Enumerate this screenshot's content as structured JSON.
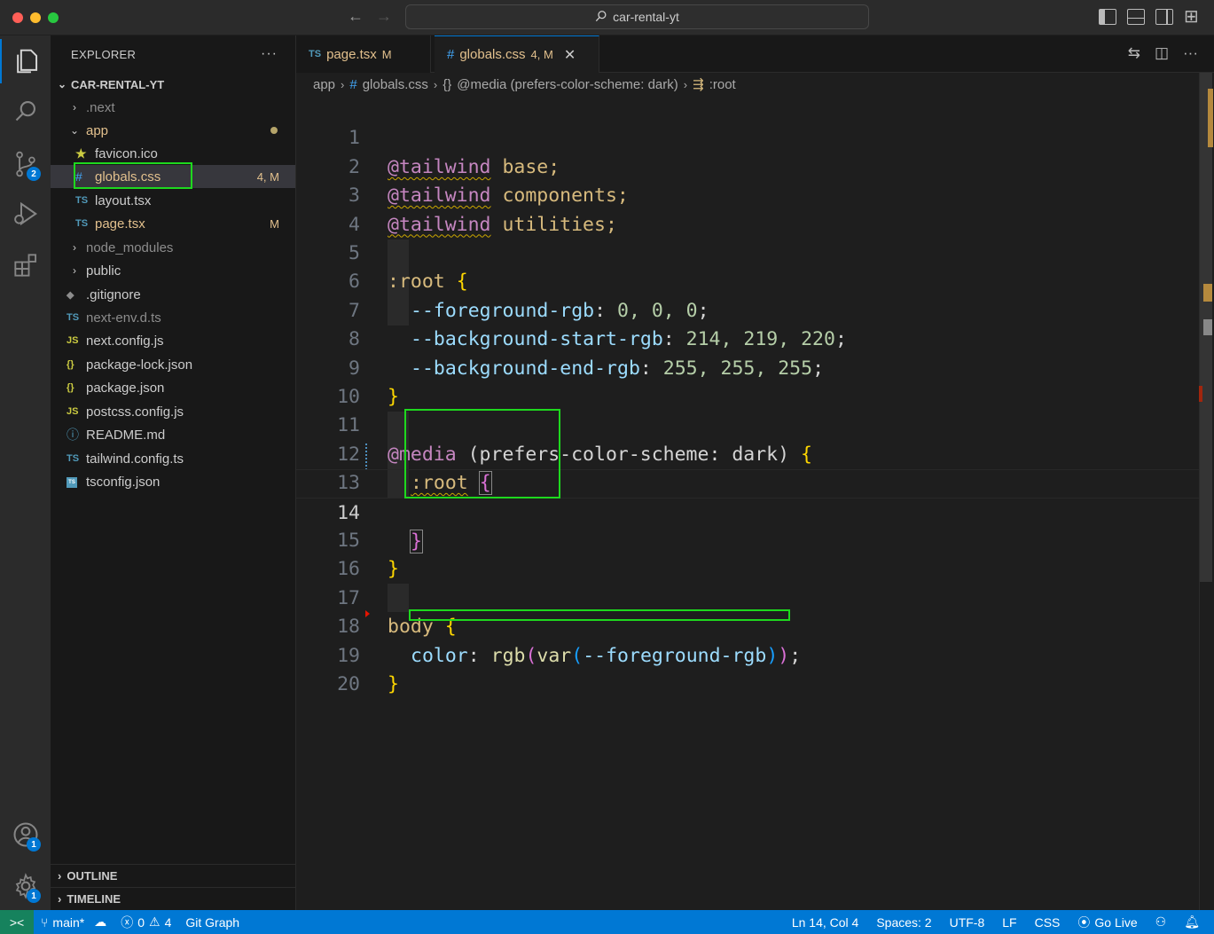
{
  "window": {
    "title": "car-rental-yt"
  },
  "sidebar": {
    "title": "EXPLORER",
    "more": "···",
    "root": "CAR-RENTAL-YT",
    "items": [
      {
        "label": ".next",
        "type": "folder"
      },
      {
        "label": "app",
        "type": "folder-open"
      },
      {
        "label": "favicon.ico",
        "icon": "star-icon"
      },
      {
        "label": "globals.css",
        "icon": "#",
        "badge": "4, M"
      },
      {
        "label": "layout.tsx",
        "icon": "TS"
      },
      {
        "label": "page.tsx",
        "icon": "TS",
        "badge": "M"
      },
      {
        "label": "node_modules",
        "type": "folder"
      },
      {
        "label": "public",
        "type": "folder"
      },
      {
        "label": ".gitignore",
        "icon": "◆"
      },
      {
        "label": "next-env.d.ts",
        "icon": "TS"
      },
      {
        "label": "next.config.js",
        "icon": "JS"
      },
      {
        "label": "package-lock.json",
        "icon": "{}"
      },
      {
        "label": "package.json",
        "icon": "{}"
      },
      {
        "label": "postcss.config.js",
        "icon": "JS"
      },
      {
        "label": "README.md",
        "icon": "ⓘ"
      },
      {
        "label": "tailwind.config.ts",
        "icon": "TS"
      },
      {
        "label": "tsconfig.json",
        "icon": "TS"
      }
    ],
    "outline": "OUTLINE",
    "timeline": "TIMELINE"
  },
  "activity": {
    "scm_badge": "2",
    "account_badge": "1",
    "settings_badge": "1"
  },
  "tabs": [
    {
      "icon": "TS",
      "label": "page.tsx",
      "status": "M"
    },
    {
      "icon": "#",
      "label": "globals.css",
      "status": "4, M",
      "close": "✕"
    }
  ],
  "breadcrumb": {
    "folder": "app",
    "file": "globals.css",
    "media": "@media (prefers-color-scheme: dark)",
    "braces": "{}",
    "hash": "#",
    "root": ":root"
  },
  "code": {
    "line_numbers": [
      "1",
      "2",
      "3",
      "4",
      "5",
      "6",
      "7",
      "8",
      "9",
      "10",
      "11",
      "12",
      "13",
      "14",
      "15",
      "16",
      "17",
      "18",
      "19",
      "20"
    ],
    "l1": {
      "at": "@tailwind",
      "rest": " base;"
    },
    "l2": {
      "at": "@tailwind",
      "rest": " components;"
    },
    "l3": {
      "at": "@tailwind",
      "rest": " utilities;"
    },
    "l5": {
      "sel": ":root",
      "open": "{"
    },
    "l6": {
      "prop": "--foreground-rgb",
      "colon": ": ",
      "vals": "0, 0, 0",
      "end": ";"
    },
    "l7": {
      "prop": "--background-start-rgb",
      "colon": ": ",
      "vals": "214, 219, 220",
      "end": ";"
    },
    "l8": {
      "prop": "--background-end-rgb",
      "colon": ": ",
      "vals": "255, 255, 255",
      "end": ";"
    },
    "l9": {
      "close": "}"
    },
    "l11": {
      "at": "@media",
      "paren": " (prefers-color-scheme: dark) ",
      "open": "{"
    },
    "l12": {
      "sel": ":root",
      "open": "{"
    },
    "l14": {
      "close": "}"
    },
    "l15": {
      "close": "}"
    },
    "l17": {
      "sel": "body",
      "open": "{"
    },
    "l18": {
      "prop": "color",
      "colon": ": ",
      "fn1": "rgb",
      "p1": "(",
      "fn2": "var",
      "p2": "(",
      "varname": "--foreground-rgb",
      "p2c": ")",
      "p1c": ")",
      "end": ";"
    },
    "l19": {
      "close": "}"
    }
  },
  "status": {
    "remote": "><",
    "branch": "main*",
    "errors": "0",
    "warnings": "4",
    "git_graph": "Git Graph",
    "position": "Ln 14, Col 4",
    "spaces": "Spaces: 2",
    "encoding": "UTF-8",
    "eol": "LF",
    "language": "CSS",
    "go_live": "Go Live"
  }
}
